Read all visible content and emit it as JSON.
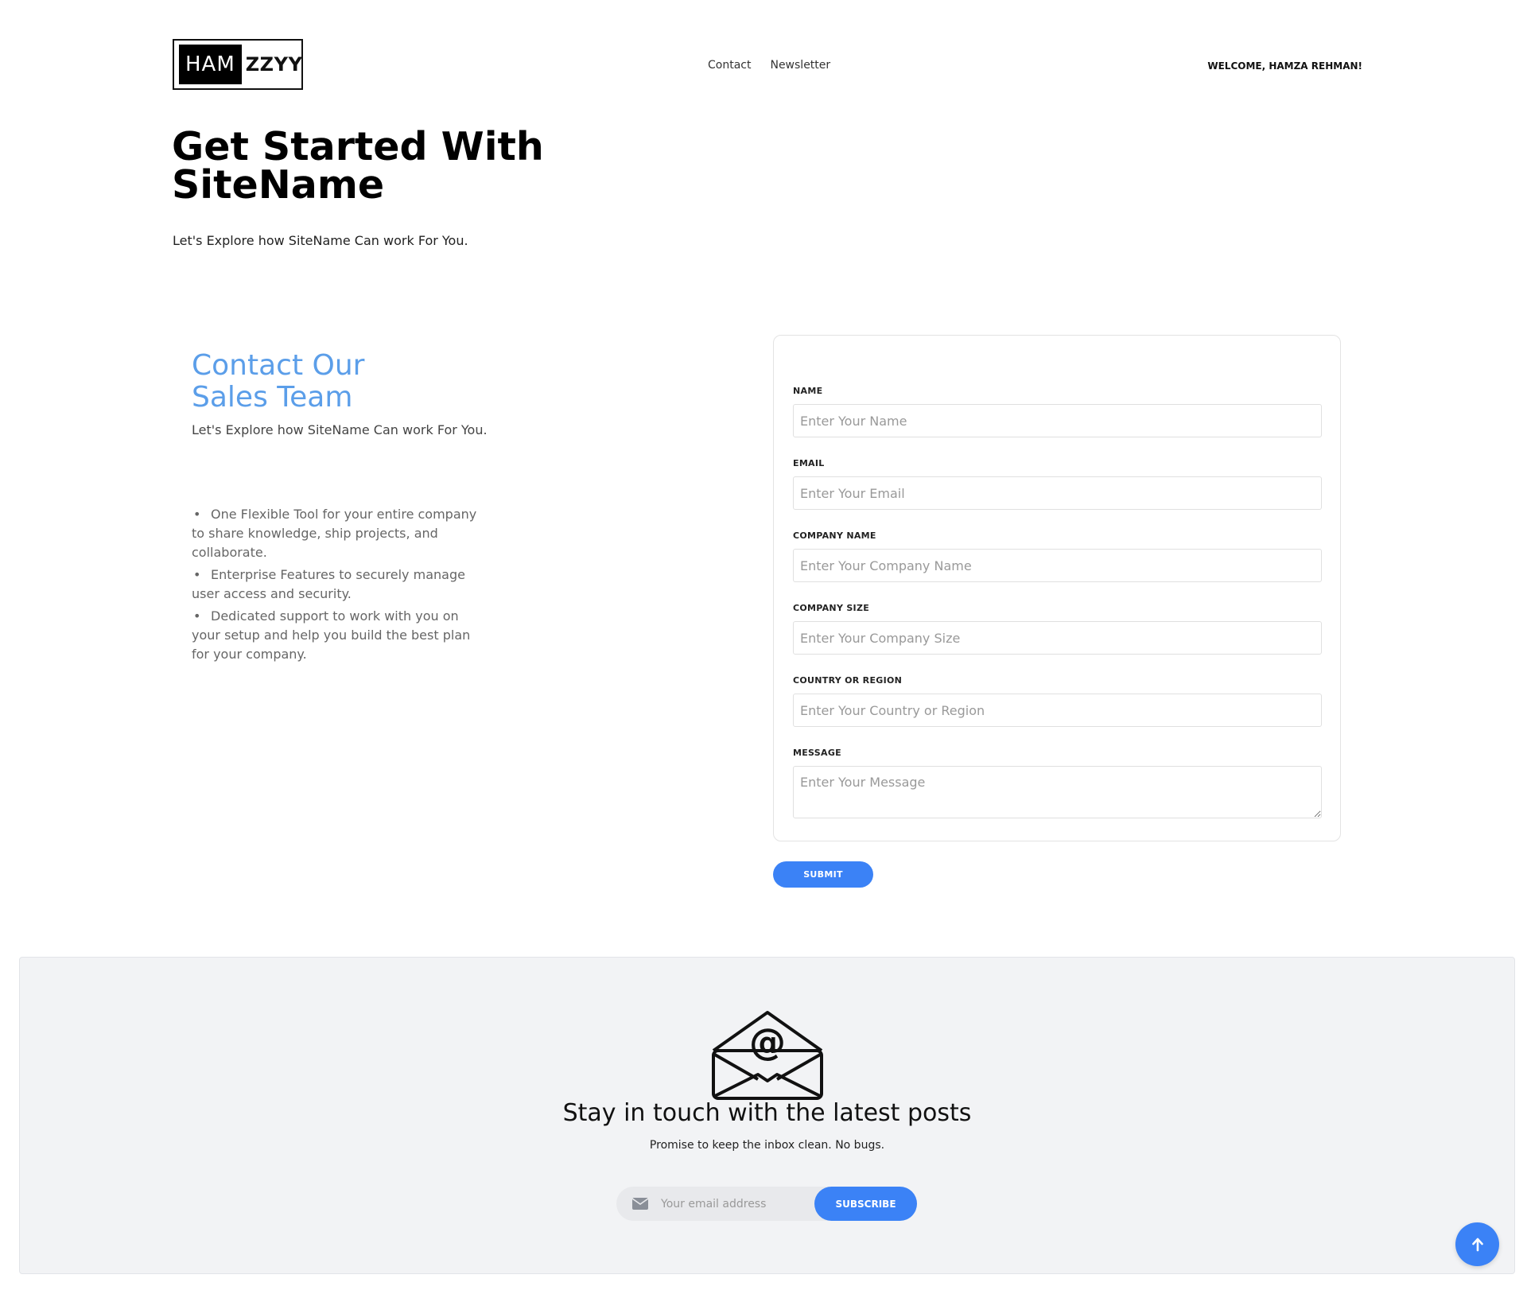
{
  "header": {
    "logo_left": "HAM",
    "logo_right": "ZZYY",
    "nav": [
      "Contact",
      "Newsletter"
    ],
    "welcome": "WELCOME, HAMZA REHMAN!"
  },
  "hero": {
    "title": "Get Started With SiteName",
    "subtitle": "Let's Explore how SiteName Can work For You."
  },
  "contact": {
    "title_line1": "Contact Our",
    "title_line2": "Sales Team",
    "subtitle": "Let's Explore how SiteName Can work For You.",
    "features": [
      "One Flexible Tool for your entire company to share knowledge, ship projects, and collaborate.",
      "Enterprise Features to securely manage user access and security.",
      "Dedicated support to work with you on your setup and help you build the best plan for your company."
    ]
  },
  "form": {
    "fields": [
      {
        "label": "NAME",
        "placeholder": "Enter Your Name",
        "value": ""
      },
      {
        "label": "EMAIL",
        "placeholder": "Enter Your Email",
        "value": ""
      },
      {
        "label": "COMPANY NAME",
        "placeholder": "Enter Your Company Name",
        "value": ""
      },
      {
        "label": "COMPANY SIZE",
        "placeholder": "Enter Your Company Size",
        "value": ""
      },
      {
        "label": "COUNTRY OR REGION",
        "placeholder": "Enter Your Country or Region",
        "value": ""
      },
      {
        "label": "MESSAGE",
        "placeholder": "Enter Your Message",
        "value": ""
      }
    ],
    "submit_label": "SUBMIT"
  },
  "newsletter": {
    "icon": "envelope-at-icon",
    "title": "Stay in touch with the latest posts",
    "subtitle": "Promise to keep the inbox clean. No bugs.",
    "email_placeholder": "Your email address",
    "subscribe_label": "SUBSCRIBE"
  },
  "scroll_top_icon": "arrow-up-icon",
  "colors": {
    "accent": "#3b82f6",
    "contact_title": "#5b9ee9",
    "newsletter_bg": "#f2f3f5"
  }
}
